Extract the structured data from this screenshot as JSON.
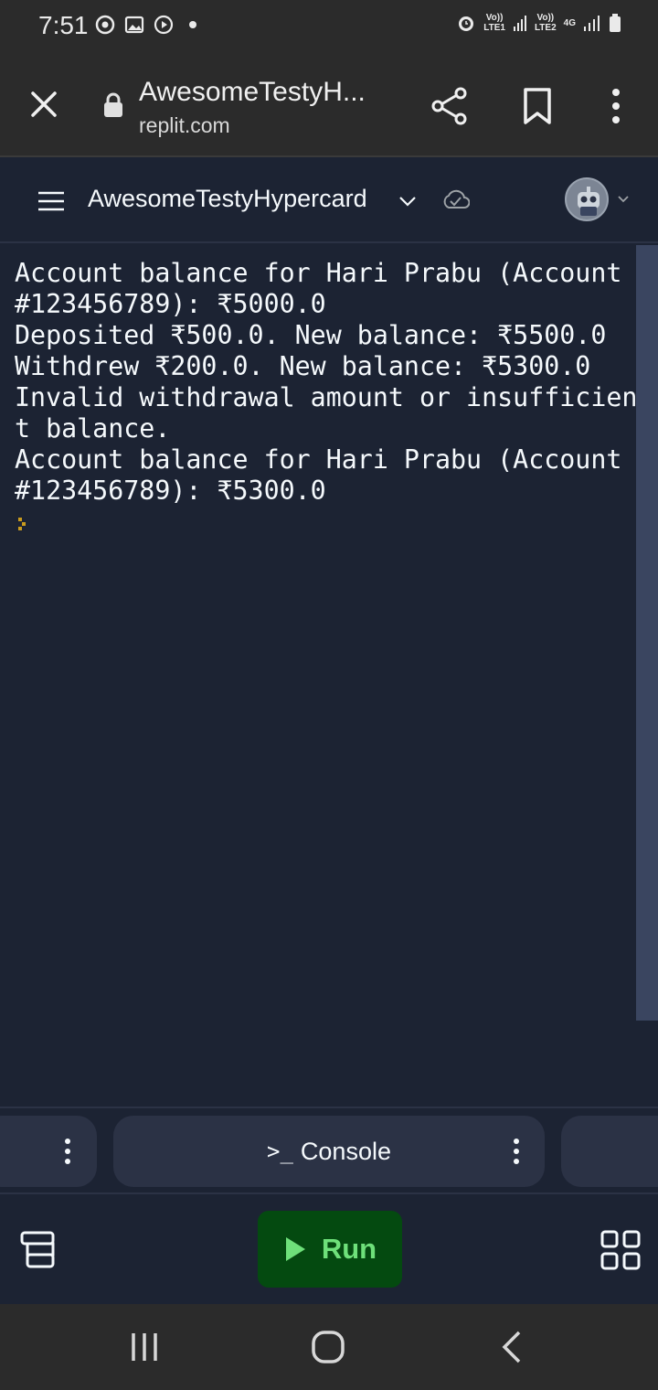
{
  "status_bar": {
    "time": "7:51",
    "network_1": "Vo))\nLTE1",
    "network_2": "Vo))\nLTE2",
    "network_type": "4G"
  },
  "browser": {
    "title": "AwesomeTestyH...",
    "domain": "replit.com"
  },
  "app_header": {
    "repl_name": "AwesomeTestyHypercard"
  },
  "console": {
    "lines": [
      "Account balance for Hari Prabu (Account",
      "#123456789): ₹5000.0",
      "Deposited ₹500.0. New balance: ₹5500.0",
      "Withdrew ₹200.0. New balance: ₹5300.0",
      "Invalid withdrawal amount or insufficien",
      "t balance.",
      "Account balance for Hari Prabu (Account",
      "#123456789): ₹5300.0"
    ]
  },
  "tabs": {
    "console_label": "Console",
    "console_prompt": ">_"
  },
  "toolbar": {
    "run_label": "Run"
  },
  "colors": {
    "background": "#1c2333",
    "panel": "#2b3245",
    "run_bg": "#044a10",
    "run_fg": "#6ee07a",
    "chrome": "#2b2b2b"
  }
}
